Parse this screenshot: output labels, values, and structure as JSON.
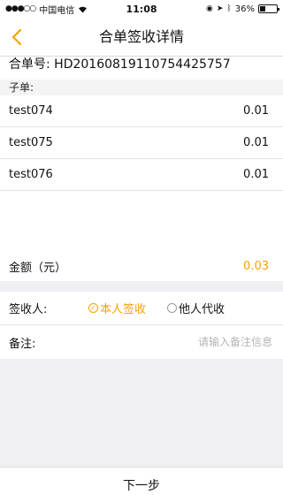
{
  "status_bar": {
    "carrier": "中国电信",
    "time": "11:08",
    "battery_percent": "36%",
    "battery_level": 0.36
  },
  "nav": {
    "title": "合单签收详情",
    "back_icon": "chevron-left-icon",
    "accent_color": "#f5a300"
  },
  "order": {
    "label": "合单号:",
    "number": "HD20160819110754425757"
  },
  "sub_orders": {
    "header": "子单:",
    "items": [
      {
        "name": "test074",
        "amount": "0.01"
      },
      {
        "name": "test075",
        "amount": "0.01"
      },
      {
        "name": "test076",
        "amount": "0.01"
      }
    ]
  },
  "amount": {
    "label": "金额（元）",
    "value": "0.03"
  },
  "receiver": {
    "label": "签收人:",
    "options": [
      {
        "label": "本人签收",
        "selected": true
      },
      {
        "label": "他人代收",
        "selected": false
      }
    ]
  },
  "remark": {
    "label": "备注:",
    "placeholder": "请输入备注信息"
  },
  "footer": {
    "next_label": "下一步"
  }
}
